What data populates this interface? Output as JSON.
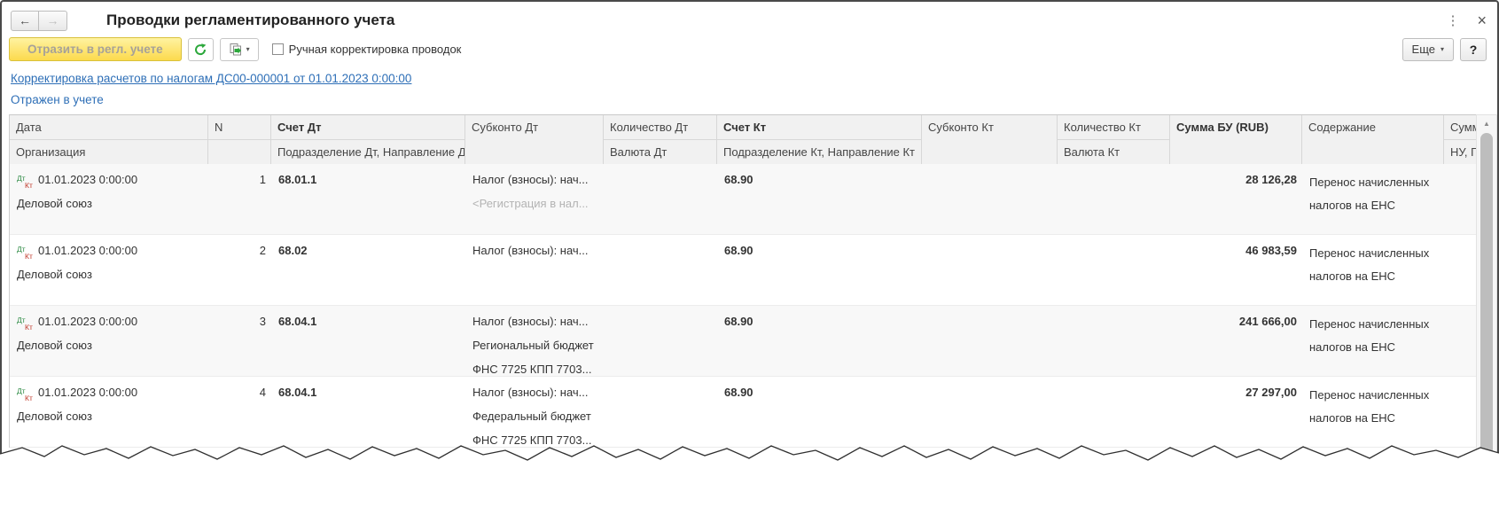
{
  "window": {
    "title": "Проводки регламентированного учета"
  },
  "icons": {
    "back": "←",
    "forward": "→",
    "menu": "⋮",
    "close": "×",
    "dropdown": "▾",
    "scroll_up": "▲"
  },
  "toolbar": {
    "reflect_label": "Отразить в регл. учете",
    "manual_adjust_label": "Ручная корректировка проводок",
    "more_label": "Еще",
    "help_label": "?"
  },
  "links": {
    "document": "Корректировка расчетов по налогам ДС00-000001 от 01.01.2023 0:00:00",
    "status": "Отражен в учете"
  },
  "colors": {
    "accent_yellow": "#fcda4d",
    "link_blue": "#2e6fb7",
    "debit_green": "#2e8b45",
    "credit_red": "#c0392b"
  },
  "table": {
    "dt_label": "Дт",
    "kt_label": "Кт",
    "header": {
      "date": "Дата",
      "org": "Организация",
      "n": "N",
      "account_dt": "Счет Дт",
      "subdivision_dt": "Подразделение Дт, Направление Дт",
      "subconto_dt": "Субконто Дт",
      "quantity_dt": "Количество Дт",
      "currency_dt": "Валюта Дт",
      "account_kt": "Счет Кт",
      "subdivision_kt": "Подразделение Кт, Направление Кт",
      "subconto_kt": "Субконто Кт",
      "quantity_kt": "Количество Кт",
      "currency_kt": "Валюта Кт",
      "amount_bu": "Сумма БУ (RUB)",
      "content": "Содержание",
      "amount2": "Сумма",
      "amount2_sub": "НУ, ПР"
    },
    "rows": [
      {
        "date": "01.01.2023 0:00:00",
        "org": "Деловой союз",
        "n": "1",
        "account_dt": "68.01.1",
        "subconto_dt_1": "Налог (взносы): нач...",
        "subconto_dt_2": "<Регистрация в нал...",
        "subconto_dt_3": "",
        "account_kt": "68.90",
        "amount": "28 126,28",
        "content": "Перенос начисленных налогов на ЕНС"
      },
      {
        "date": "01.01.2023 0:00:00",
        "org": "Деловой союз",
        "n": "2",
        "account_dt": "68.02",
        "subconto_dt_1": "Налог (взносы): нач...",
        "subconto_dt_2": "",
        "subconto_dt_3": "",
        "account_kt": "68.90",
        "amount": "46 983,59",
        "content": "Перенос начисленных налогов на ЕНС"
      },
      {
        "date": "01.01.2023 0:00:00",
        "org": "Деловой союз",
        "n": "3",
        "account_dt": "68.04.1",
        "subconto_dt_1": "Налог (взносы): нач...",
        "subconto_dt_2": "Региональный бюджет",
        "subconto_dt_3": "ФНС 7725 КПП 7703...",
        "account_kt": "68.90",
        "amount": "241 666,00",
        "content": "Перенос начисленных налогов на ЕНС"
      },
      {
        "date": "01.01.2023 0:00:00",
        "org": "Деловой союз",
        "n": "4",
        "account_dt": "68.04.1",
        "subconto_dt_1": "Налог (взносы): нач...",
        "subconto_dt_2": "Федеральный бюджет",
        "subconto_dt_3": "ФНС 7725 КПП 7703...",
        "account_kt": "68.90",
        "amount": "27 297,00",
        "content": "Перенос начисленных налогов на ЕНС"
      }
    ]
  }
}
